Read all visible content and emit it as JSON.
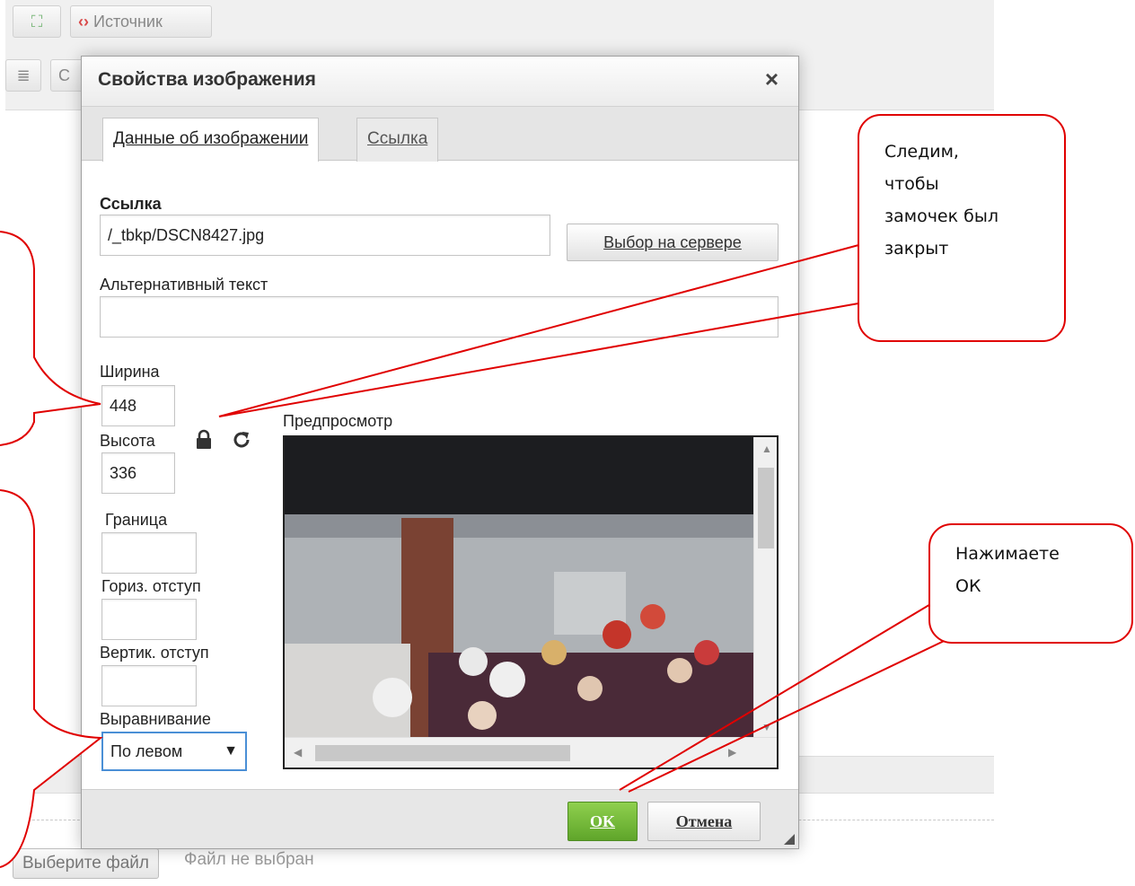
{
  "toolbar": {
    "maximize_label": "⛶",
    "source_label": "Источник",
    "align_label": "≣",
    "row2_partial": "С"
  },
  "dialog": {
    "title": "Свойства изображения",
    "close_glyph": "×",
    "tabs": [
      {
        "label": "Данные об изображении",
        "active": true
      },
      {
        "label": "Ссылка",
        "active": false
      }
    ],
    "url_label": "Ссылка",
    "url_value": "/_tbkp/DSCN8427.jpg",
    "browse_button": "Выбор на сервере",
    "alt_label": "Альтернативный текст",
    "alt_value": "",
    "width_label": "Ширина",
    "width_value": "448",
    "height_label": "Высота",
    "height_value": "336",
    "border_label": "Граница",
    "border_value": "",
    "hspace_label": "Гориз. отступ",
    "hspace_value": "",
    "vspace_label": "Вертик. отступ",
    "vspace_value": "",
    "align_label": "Выравнивание",
    "align_value": "По левом",
    "align_arrow": "▼",
    "preview_label": "Предпросмотр",
    "ok_button": "OK",
    "cancel_button": "Отмена"
  },
  "file_input": {
    "button_label": "Выберите файл",
    "status": "Файл не выбран"
  },
  "callouts": {
    "lock_note": [
      "Следим,",
      "чтобы",
      "замочек был",
      "закрыт"
    ],
    "ok_note": [
      "Нажимаете",
      "ОК"
    ]
  },
  "colors": {
    "annotation": "#e00000",
    "ok_green": "#6ab630",
    "select_focus": "#4a8fd6"
  }
}
